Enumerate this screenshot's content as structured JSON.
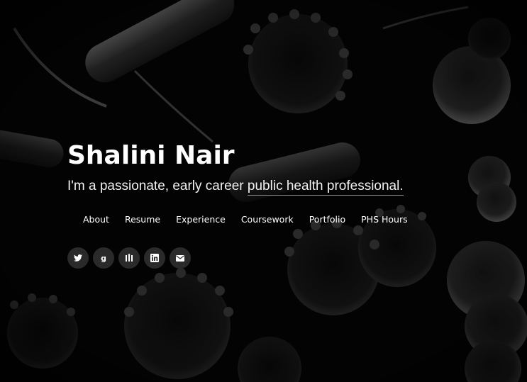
{
  "profile": {
    "name": "Shalini Nair",
    "tagline_prefix": "I'm a passionate, early career ",
    "tagline_highlight": "public health professional."
  },
  "nav": {
    "items": [
      "About",
      "Resume",
      "Experience",
      "Coursework",
      "Portfolio",
      "PHS Hours"
    ]
  },
  "social": {
    "icons": [
      "twitter-icon",
      "google-icon",
      "mendeley-icon",
      "linkedin-icon",
      "email-icon"
    ],
    "google_glyph": "g"
  },
  "colors": {
    "background": "#050505",
    "text": "#ffffff",
    "accent_underline": "#2fb5a4",
    "social_button": "#2a2a2a"
  }
}
